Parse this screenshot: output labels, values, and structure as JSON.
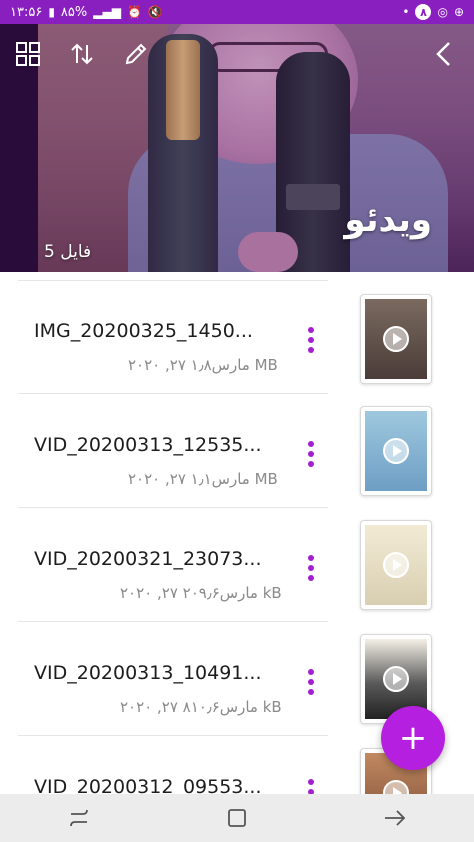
{
  "status_bar": {
    "time": "۱۳:۵۶",
    "battery": "۸۵%",
    "notification_count": "۸"
  },
  "header": {
    "title": "ویدئو",
    "file_count": "5 فایل"
  },
  "files": [
    {
      "name": "IMG_20200325_1450...",
      "meta": "۲۰۲۰ ,۲۷ مارس۱٫۸ MB"
    },
    {
      "name": "VID_20200313_12535...",
      "meta": "۲۰۲۰ ,۲۷ مارس۱٫۱ MB"
    },
    {
      "name": "VID_20200321_23073...",
      "meta": "۲۰۲۰ ,۲۷ مارس۲۰۹٫۶ kB"
    },
    {
      "name": "VID_20200313_10491...",
      "meta": "۲۰۲۰ ,۲۷ مارس۸۱۰٫۶ kB"
    },
    {
      "name": "VID_20200312_09553...",
      "meta": ""
    }
  ],
  "fab": {
    "label": "+"
  },
  "colors": {
    "accent": "#b41fe0",
    "status_bar": "#8a1fc0",
    "more_dots": "#a31fd0"
  },
  "icons": {
    "grid": "grid-icon",
    "sort": "sort-icon",
    "edit": "pencil-icon",
    "back": "back-arrow-icon",
    "more": "more-vertical-icon",
    "play": "play-icon",
    "nav_recents": "recents-icon",
    "nav_home": "home-icon",
    "nav_back": "nav-back-icon"
  }
}
